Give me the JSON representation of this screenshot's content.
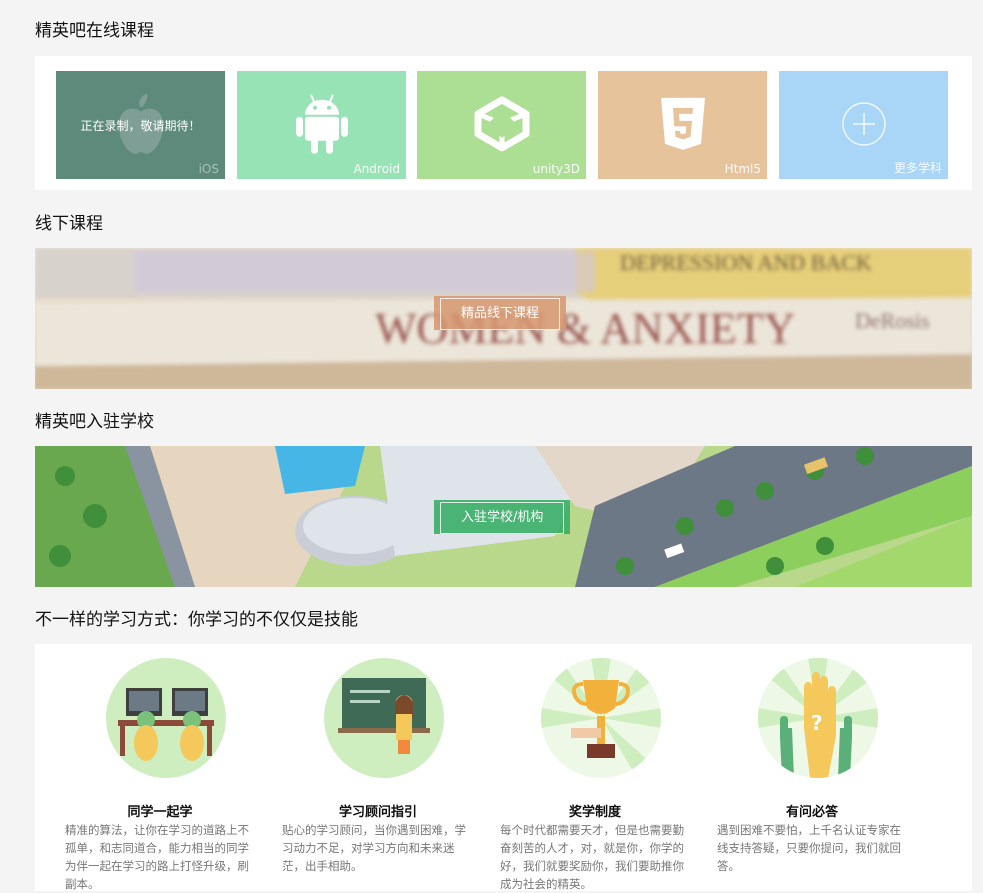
{
  "sections": {
    "online": "精英吧在线课程",
    "offline": "线下课程",
    "schools": "精英吧入驻学校",
    "features": "不一样的学习方式：你学习的不仅仅是技能"
  },
  "courses": [
    {
      "name": "iOS",
      "overlay": "正在录制，敬请期待！",
      "icon": "apple-icon",
      "color": "#5e8a7c"
    },
    {
      "name": "Android",
      "icon": "android-icon",
      "color": "#98e3b6"
    },
    {
      "name": "unity3D",
      "icon": "unity-icon",
      "color": "#acdf94"
    },
    {
      "name": "Html5",
      "icon": "html5-icon",
      "color": "#e7c39c"
    },
    {
      "name": "更多学科",
      "icon": "plus-circle-icon",
      "color": "#a9d5f6"
    }
  ],
  "offline_banner": {
    "button": "精品线下课程",
    "book_title_1": "DEPRESSION AND BACK",
    "book_title_2": "WOMEN & ANXIETY",
    "book_author": "DeRosis"
  },
  "school_banner": {
    "button": "入驻学校/机构"
  },
  "features": [
    {
      "title": "同学一起学",
      "desc": "精准的算法，让你在学习的道路上不孤单，和志同道合，能力相当的同学为伴一起在学习的路上打怪升级，刷副本。"
    },
    {
      "title": "学习顾问指引",
      "desc": "贴心的学习顾问，当你遇到困难，学习动力不足，对学习方向和未来迷茫，出手相助。"
    },
    {
      "title": "奖学制度",
      "desc": "每个时代都需要天才，但是也需要勤奋刻苦的人才，对，就是你，你学的好，我们就要奖励你，我们要助推你成为社会的精英。"
    },
    {
      "title": "有问必答",
      "desc": "遇到困难不要怕，上千名认证专家在线支持答疑，只要你提问，我们就回答。"
    }
  ],
  "colors": {
    "page_bg": "#f4f4f4",
    "panel_bg": "#ffffff",
    "offline_btn": "#d9a07e",
    "school_btn": "#3dae6a"
  }
}
